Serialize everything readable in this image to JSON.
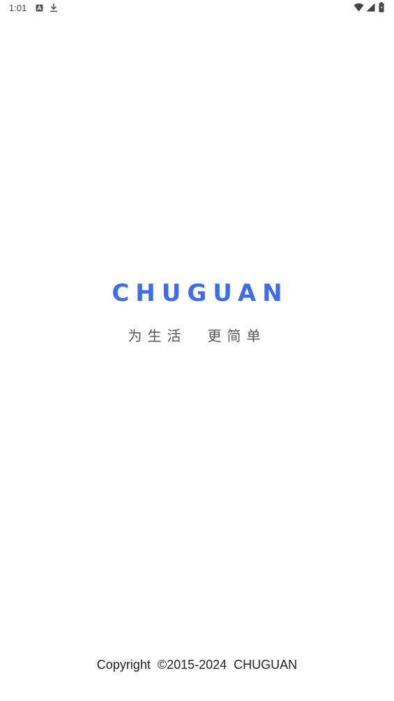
{
  "status_bar": {
    "time": "1:01",
    "icons": [
      "notification-a-icon",
      "download-icon",
      "wifi-icon",
      "signal-icon",
      "battery-icon"
    ]
  },
  "splash": {
    "logo_text": "CHUGUAN",
    "slogan_left": "为生活",
    "slogan_right": "更简单",
    "copyright": "Copyright  ©2015-2024  CHUGUAN"
  },
  "colors": {
    "brand": "#3d6cf0",
    "slogan": "#555555",
    "background": "#ffffff"
  }
}
